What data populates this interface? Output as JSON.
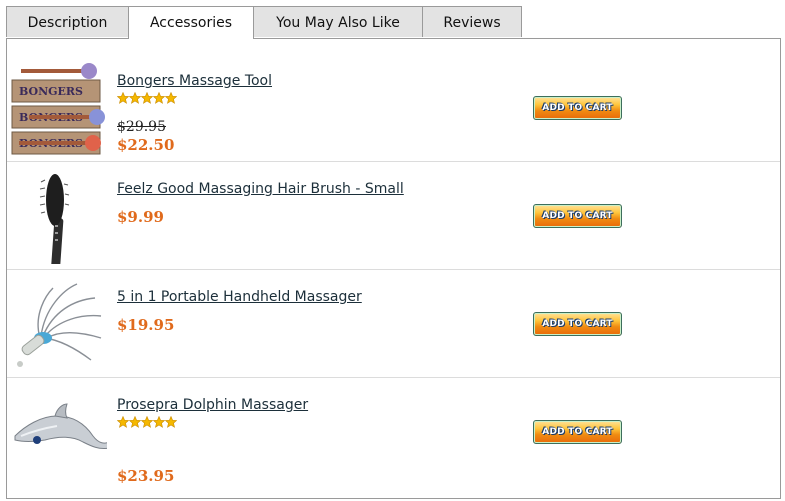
{
  "tabs": [
    {
      "label": "Description"
    },
    {
      "label": "Accessories"
    },
    {
      "label": "You May Also Like"
    },
    {
      "label": "Reviews"
    }
  ],
  "active_tab": "Accessories",
  "products": [
    {
      "name": "Bongers Massage Tool",
      "rating": 5,
      "old_price": "$29.95",
      "price": "$22.50",
      "cart_label": "ADD TO CART",
      "image": "bongers-massage-tool-image"
    },
    {
      "name": "Feelz Good Massaging Hair Brush - Small",
      "price": "$9.99",
      "cart_label": "ADD TO CART",
      "image": "hair-brush-image"
    },
    {
      "name": "5 in 1 Portable Handheld Massager",
      "price": "$19.95",
      "cart_label": "ADD TO CART",
      "image": "handheld-massager-image"
    },
    {
      "name": "Prosepra Dolphin Massager",
      "rating": 5,
      "price": "$23.95",
      "cart_label": "ADD TO CART",
      "image": "dolphin-massager-image"
    }
  ],
  "colors": {
    "price": "#e06a1c",
    "link": "#1c2f3a",
    "star": "#f5b800"
  }
}
